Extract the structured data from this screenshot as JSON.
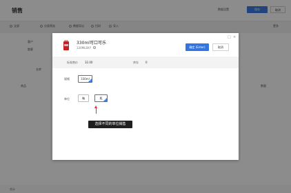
{
  "app": {
    "title": "销售",
    "header_link": "数据设置",
    "primary_button": "保存",
    "secondary_button": "取消"
  },
  "toolbar": {
    "items": [
      "全部",
      "分类筛选",
      "数据导出",
      "扫码",
      "导入"
    ],
    "right": "更多"
  },
  "panel": {
    "customer_label": "客户",
    "customer_value": "散客",
    "warehouse_label": "仓库",
    "goods_label": "商品",
    "qty_label": "数量"
  },
  "footer": {
    "text": "合计"
  },
  "modal": {
    "product_name": "330ml可口可乐",
    "product_code": "330ML8XY",
    "confirm_button": "确定 (Enter)",
    "cancel_button": "取消",
    "price_label": "标准售价",
    "price_value": "32.00",
    "stock_label": "库存",
    "stock_value": "0",
    "spec_label": "规格",
    "spec_option": "330ml",
    "unit_label": "单位",
    "unit_options": [
      "箱",
      "瓶"
    ],
    "selected_unit_index": 1,
    "tooltip": "选择不同的单位销售"
  },
  "colors": {
    "accent": "#3375e0",
    "arrow": "#e0303a",
    "tooltip_bg": "#1f1f1f"
  }
}
